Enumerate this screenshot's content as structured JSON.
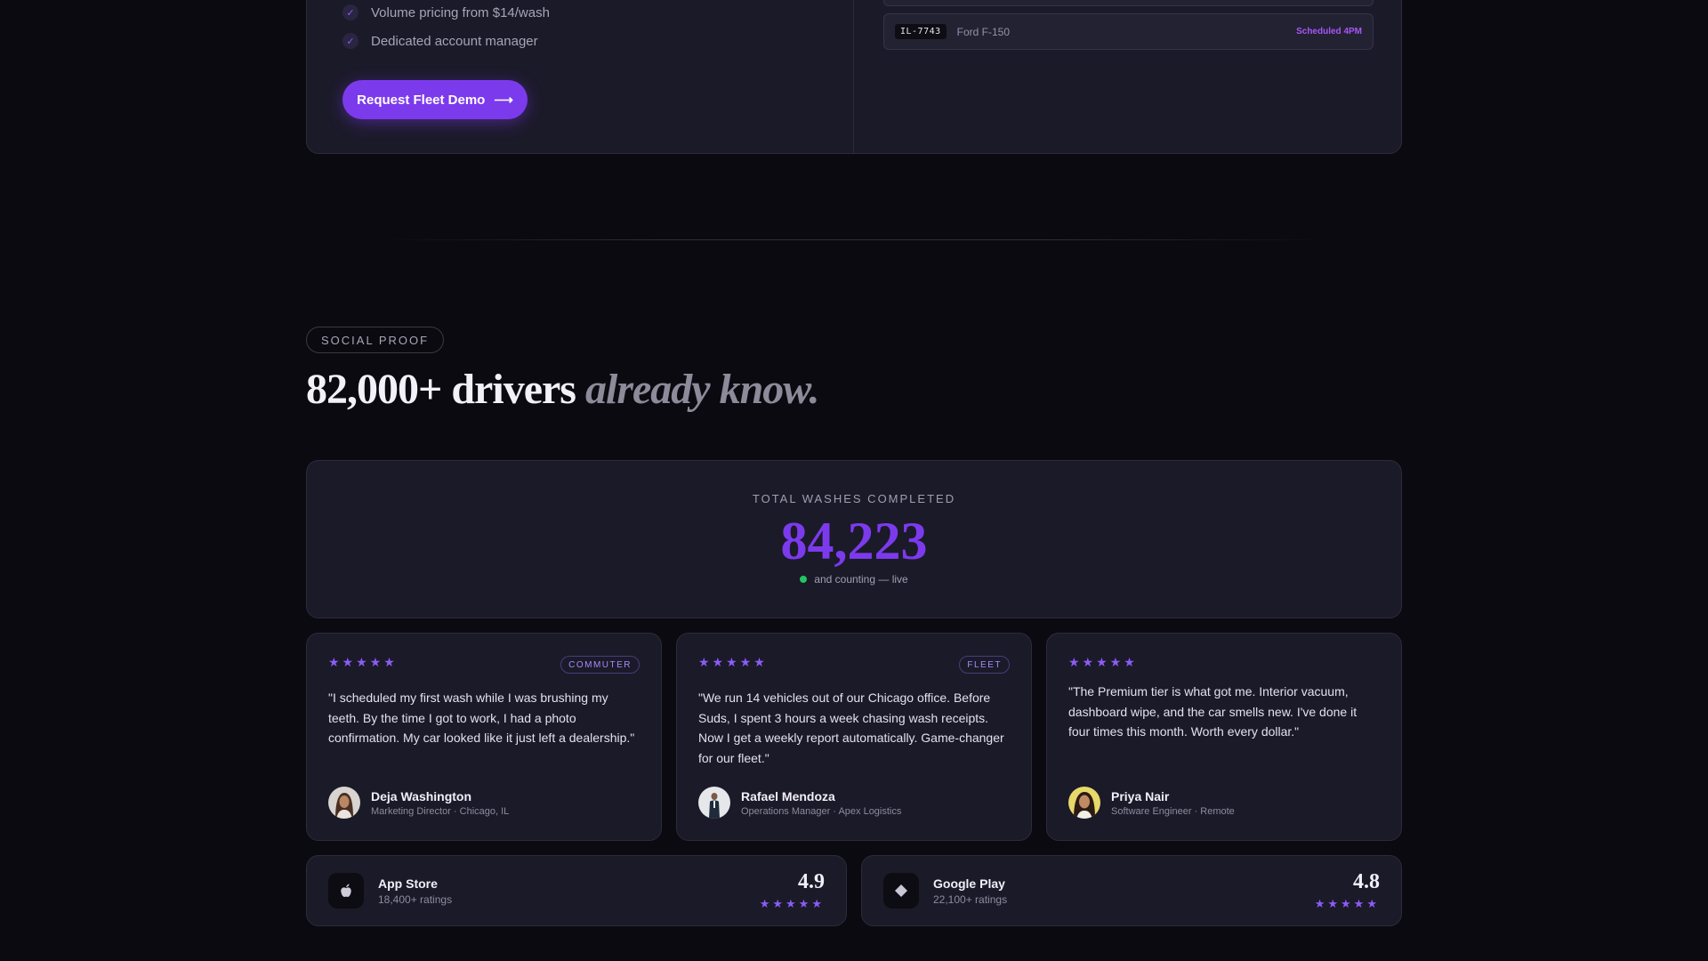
{
  "fleet": {
    "features": [
      {
        "text": "Volume pricing from $14/wash"
      },
      {
        "text": "Dedicated account manager"
      }
    ],
    "cta_label": "Request Fleet Demo",
    "cta_arrow": "⟶",
    "vehicle": {
      "plate": "IL-7743",
      "model": "Ford F-150",
      "status": "Scheduled 4PM"
    }
  },
  "social_proof": {
    "pill": "SOCIAL PROOF",
    "headline_strong": "82,000+ drivers",
    "headline_soft": "already know."
  },
  "counter": {
    "label": "TOTAL WASHES COMPLETED",
    "value": "84,223",
    "live_text": "and counting — live"
  },
  "testimonials": [
    {
      "stars": "★★★★★",
      "tag": "COMMUTER",
      "quote": "\"I scheduled my first wash while I was brushing my teeth. By the time I got to work, I had a photo confirmation. My car looked like it just left a dealership.\"",
      "name": "Deja Washington",
      "role": "Marketing Director · Chicago, IL"
    },
    {
      "stars": "★★★★★",
      "tag": "FLEET",
      "quote": "\"We run 14 vehicles out of our Chicago office. Before Suds, I spent 3 hours a week chasing wash receipts. Now I get a weekly report automatically. Game-changer for our fleet.\"",
      "name": "Rafael Mendoza",
      "role": "Operations Manager · Apex Logistics"
    },
    {
      "stars": "★★★★★",
      "tag": "",
      "quote": "\"The Premium tier is what got me. Interior vacuum, dashboard wipe, and the car smells new. I've done it four times this month. Worth every dollar.\"",
      "name": "Priya Nair",
      "role": "Software Engineer · Remote"
    }
  ],
  "stores": [
    {
      "name": "App Store",
      "count": "18,400+ ratings",
      "rating": "4.9",
      "stars": "★★★★★",
      "icon": "apple-icon"
    },
    {
      "name": "Google Play",
      "count": "22,100+ ratings",
      "rating": "4.8",
      "stars": "★★★★★",
      "icon": "google-play-icon"
    }
  ],
  "colors": {
    "accent": "#7c3aed",
    "star": "#8b5cf6",
    "live": "#22c55e",
    "card": "#1b1a29",
    "background": "#0b0a10"
  }
}
